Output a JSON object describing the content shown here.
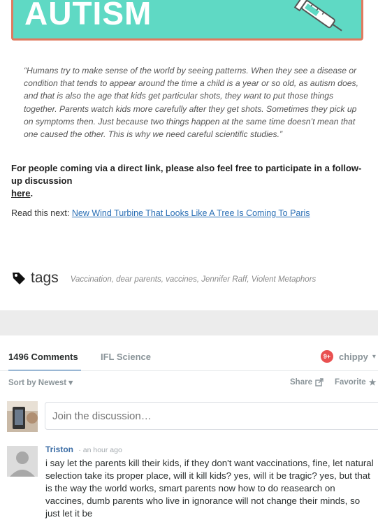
{
  "banner": {
    "title": "AUTISM"
  },
  "article": {
    "quote": "“Humans try to make sense of the world by seeing patterns. When they see a disease or condition that tends to appear around the time a child is a year or so old, as autism does, and that is also the age that kids get particular shots, they want to put those things together. Parents watch kids more carefully after they get shots. Sometimes they pick up on symptoms then. Just because two things happen at the same time doesn’t mean that one caused the other. This is why we need careful scientific studies.”",
    "direct_link_note": "For people coming via a direct link, please also feel free to participate in a follow-up discussion",
    "here_link": "here",
    "here_period": ".",
    "read_next_label": "Read this next:",
    "read_next_link": "New Wind Turbine That Looks Like A Tree Is Coming To Paris"
  },
  "tags": {
    "label": "tags",
    "list": "Vaccination, dear parents, vaccines, Jennifer Raff, Violent Metaphors"
  },
  "comments": {
    "count_label": "1496 Comments",
    "community_label": "IFL Science",
    "badge": "9+",
    "username": "chippy",
    "user_chevron": "▾",
    "sort_label": "Sort by Newest ▾",
    "share_label": "Share",
    "favorite_label": "Favorite",
    "favorite_icon": "★",
    "join_placeholder": "Join the discussion…",
    "items": [
      {
        "author": "Triston",
        "time": "· an hour ago",
        "text": "i say let the parents kill their kids, if they don't want vaccinations, fine, let natural selection take its proper place, will it kill kids? yes, will it be tragic? yes, but that is the way the world works, smart parents now how to do reasearch on vaccines, dumb parents who live in ignorance will not change their minds, so just let it be"
      }
    ]
  },
  "colors": {
    "banner_bg": "#5fd9c4",
    "banner_border": "#e07a5f",
    "link": "#2a6fb5",
    "author": "#3d6ea6",
    "badge": "#e95050"
  },
  "icons": [
    "syringe-icon",
    "tag-icon",
    "share-icon",
    "star-icon",
    "chevron-down-icon"
  ]
}
